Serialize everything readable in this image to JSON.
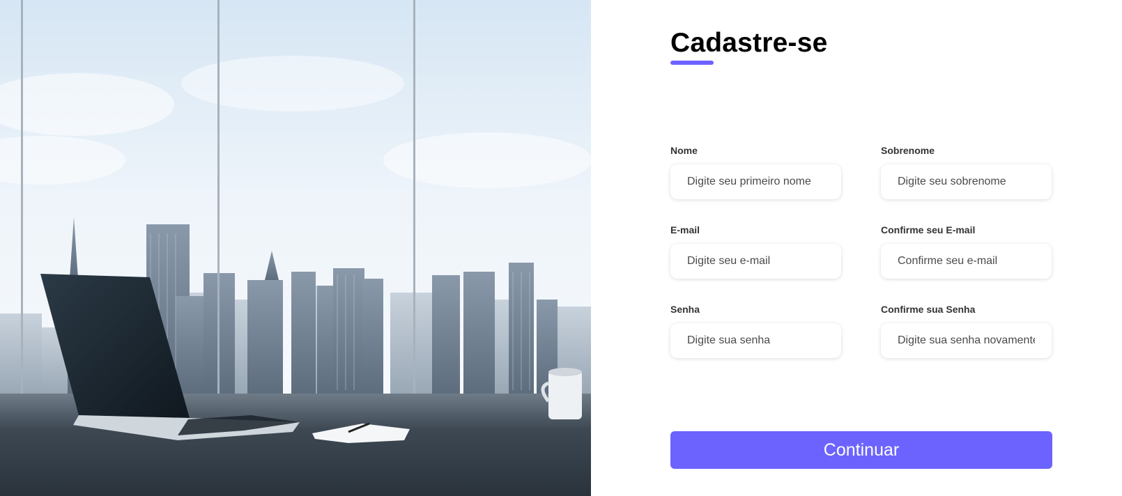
{
  "form": {
    "title": "Cadastre-se",
    "fields": {
      "first_name": {
        "label": "Nome",
        "placeholder": "Digite seu primeiro nome"
      },
      "last_name": {
        "label": "Sobrenome",
        "placeholder": "Digite seu sobrenome"
      },
      "email": {
        "label": "E-mail",
        "placeholder": "Digite seu e-mail"
      },
      "confirm_email": {
        "label": "Confirme seu E-mail",
        "placeholder": "Confirme seu e-mail"
      },
      "password": {
        "label": "Senha",
        "placeholder": "Digite sua senha"
      },
      "confirm_password": {
        "label": "Confirme sua Senha",
        "placeholder": "Digite sua senha novamente"
      }
    },
    "submit_label": "Continuar"
  },
  "colors": {
    "accent": "#6c63ff",
    "title": "#000000",
    "label": "#333333",
    "background": "#ffffff"
  }
}
